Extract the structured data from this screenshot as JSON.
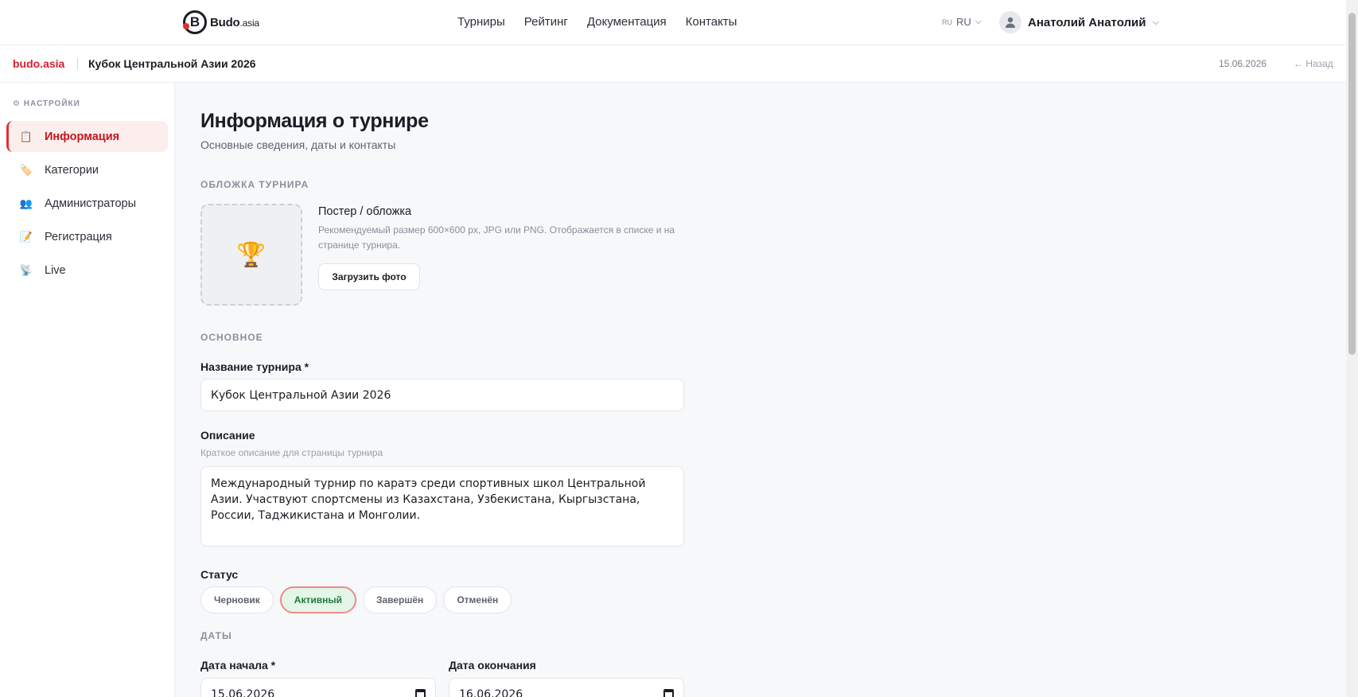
{
  "topnav": {
    "logo_text": "Budo",
    "logo_suffix": ".asia",
    "links": [
      "Турниры",
      "Рейтинг",
      "Документация",
      "Контакты"
    ],
    "lang_small": "RU",
    "lang": "RU",
    "user_name": "Анатолий Анатолий"
  },
  "subheader": {
    "brand": "budo.asia",
    "title": "Кубок Центральной Азии 2026",
    "date": "15.06.2026",
    "back": "← Назад"
  },
  "sidebar": {
    "heading": "⚙ НАСТРОЙКИ",
    "items": [
      {
        "label": "Информация",
        "icon": "📋"
      },
      {
        "label": "Категории",
        "icon": "🏷️"
      },
      {
        "label": "Администраторы",
        "icon": "👥"
      },
      {
        "label": "Регистрация",
        "icon": "📝"
      },
      {
        "label": "Live",
        "icon": "📡"
      }
    ]
  },
  "main": {
    "title": "Информация о турнире",
    "subtitle": "Основные сведения, даты и контакты",
    "cover_section": "ОБЛОЖКА ТУРНИРА",
    "cover_icon": "🏆",
    "cover_title": "Постер / обложка",
    "cover_hint": "Рекомендуемый размер 600×600 px, JPG или PNG. Отображается в списке и на странице турнира.",
    "upload_label": "Загрузить фото",
    "basic_section": "ОСНОВНОЕ",
    "name_label": "Название турнира *",
    "name_value": "Кубок Центральной Азии 2026",
    "desc_label": "Описание",
    "desc_hint": "Краткое описание для страницы турнира",
    "desc_value": "Международный турнир по каратэ среди спортивных школ Центральной Азии. Участвуют спортсмены из Казахстана, Узбекистана, Кыргызстана, России, Таджикистана и Монголии.",
    "status_label": "Статус",
    "statuses": [
      "Черновик",
      "Активный",
      "Завершён",
      "Отменён"
    ],
    "status_selected": "Активный",
    "dates_section": "ДАТЫ",
    "start_label": "Дата начала *",
    "start_value": "15.06.2026",
    "end_label": "Дата окончания",
    "end_value": "16.06.2026"
  }
}
